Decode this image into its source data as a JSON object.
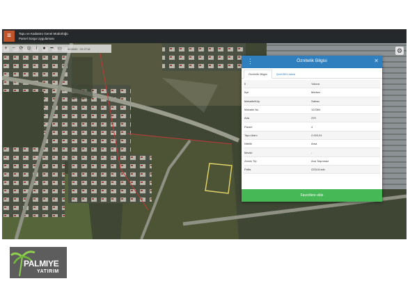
{
  "app": {
    "title_line1": "Tapu ve Kadastro Genel Müdürlüğü",
    "title_line2": "Parsel Sorgu Uygulaması",
    "coordinates": "40.6530 · 29.2718"
  },
  "toolbar": {
    "icons": [
      "plus-icon",
      "minus-icon",
      "refresh-icon",
      "locate-icon",
      "info-icon",
      "pin-icon",
      "ruler-icon",
      "printer-icon"
    ]
  },
  "popup": {
    "title": "Öznitelik Bilgisi",
    "tabs": [
      "Öznitelik Bilgisi",
      "Şerh/Bill Listesi"
    ],
    "rows": [
      {
        "key": "İl",
        "value": "Yalova"
      },
      {
        "key": "İlçe",
        "value": "Merkez"
      },
      {
        "key": "Mahalle/Köy",
        "value": "Safran"
      },
      {
        "key": "Mahalle No",
        "value": "122364"
      },
      {
        "key": "Ada",
        "value": "229"
      },
      {
        "key": "Parsel",
        "value": "4"
      },
      {
        "key": "Tapu Alanı",
        "value": "2.003,91"
      },
      {
        "key": "Nitelik",
        "value": "Arsa"
      },
      {
        "key": "Mevkii",
        "value": "-"
      },
      {
        "key": "Zemin Tip",
        "value": "Ana Taşınmaz"
      },
      {
        "key": "Pafta",
        "value": "G22c11a4c"
      }
    ],
    "favorite_button": "Favorilere ekle"
  },
  "logo": {
    "name": "PALMIYE",
    "sub": "YATIRIM"
  },
  "colors": {
    "header": "#2f7fbf",
    "button": "#47b856",
    "menu": "#c0542b"
  }
}
